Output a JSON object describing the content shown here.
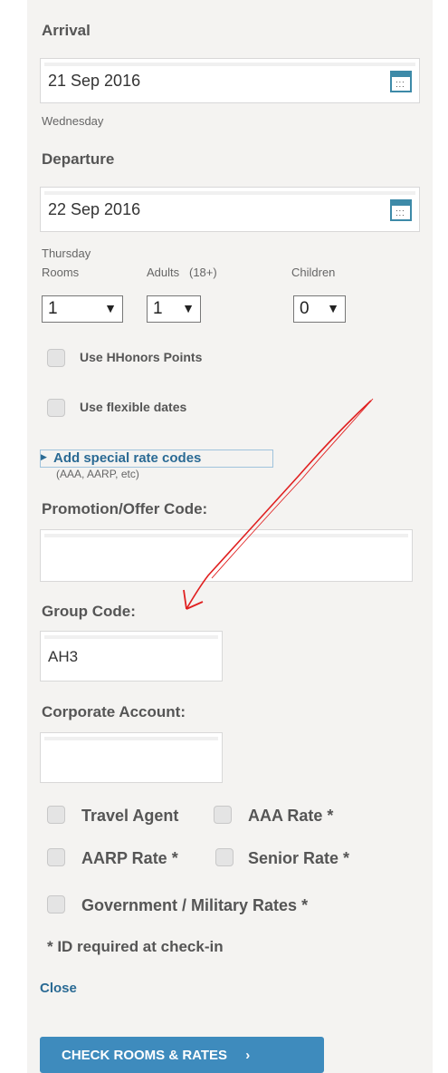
{
  "arrival": {
    "label": "Arrival",
    "date": "21 Sep 2016",
    "weekday": "Wednesday"
  },
  "departure": {
    "label": "Departure",
    "date": "22 Sep 2016",
    "weekday": "Thursday"
  },
  "rooms": {
    "label": "Rooms",
    "value": "1"
  },
  "adults": {
    "label": "Adults",
    "note": "(18+)",
    "value": "1"
  },
  "children": {
    "label": "Children",
    "value": "0"
  },
  "options": {
    "hhonors": "Use HHonors Points",
    "flexible": "Use flexible dates"
  },
  "special_rates": {
    "link": "Add special rate codes",
    "hint": "(AAA, AARP, etc)"
  },
  "promo": {
    "label": "Promotion/Offer Code:",
    "value": ""
  },
  "group": {
    "label": "Group Code:",
    "value": "AH3"
  },
  "corporate": {
    "label": "Corporate Account:",
    "value": ""
  },
  "rates": {
    "travel_agent": "Travel Agent",
    "aaa": "AAA Rate *",
    "aarp": "AARP Rate *",
    "senior": "Senior Rate *",
    "government": "Government / Military Rates *"
  },
  "id_note": "* ID required at check-in",
  "close_link": "Close",
  "submit_button": "CHECK ROOMS & RATES",
  "submit_arrow": "›",
  "colors": {
    "accent": "#3e8bbd",
    "annotation": "#e02020"
  }
}
